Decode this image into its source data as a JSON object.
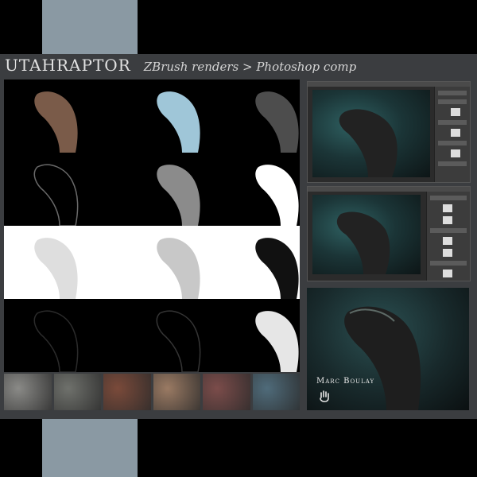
{
  "header": {
    "title": "UTAHRAPTOR",
    "subtitle": "ZBrush renders > Photoshop comp"
  },
  "render_passes": [
    {
      "pass": "color",
      "bg": "#000000",
      "fg": "#7a5b49"
    },
    {
      "pass": "cavity-blue",
      "bg": "#000000",
      "fg": "#9fc6d8"
    },
    {
      "pass": "detail",
      "bg": "#000000",
      "fg": "#4d4d4d"
    },
    {
      "pass": "outline",
      "bg": "#000000",
      "fg": "#6a6a6a"
    },
    {
      "pass": "grey",
      "bg": "#000000",
      "fg": "#8b8b8b"
    },
    {
      "pass": "mask",
      "bg": "#000000",
      "fg": "#ffffff"
    },
    {
      "pass": "light-ao",
      "bg": "#ffffff",
      "fg": "#dedede"
    },
    {
      "pass": "light-shade",
      "bg": "#ffffff",
      "fg": "#c8c8c8"
    },
    {
      "pass": "dark-mask",
      "bg": "#ffffff",
      "fg": "#111111"
    },
    {
      "pass": "edge",
      "bg": "#000000",
      "fg": "#2b2b2b"
    },
    {
      "pass": "edge-2",
      "bg": "#000000",
      "fg": "#353535"
    },
    {
      "pass": "depth",
      "bg": "#000000",
      "fg": "#e6e6e6"
    }
  ],
  "textures": [
    "#8a8a87",
    "#6f716c",
    "#7a4a3a",
    "#9a7a63",
    "#7b4c4a",
    "#4f6b7a"
  ],
  "signature": "Marc Boulay",
  "icons": {
    "hand": "hand-print-icon"
  }
}
